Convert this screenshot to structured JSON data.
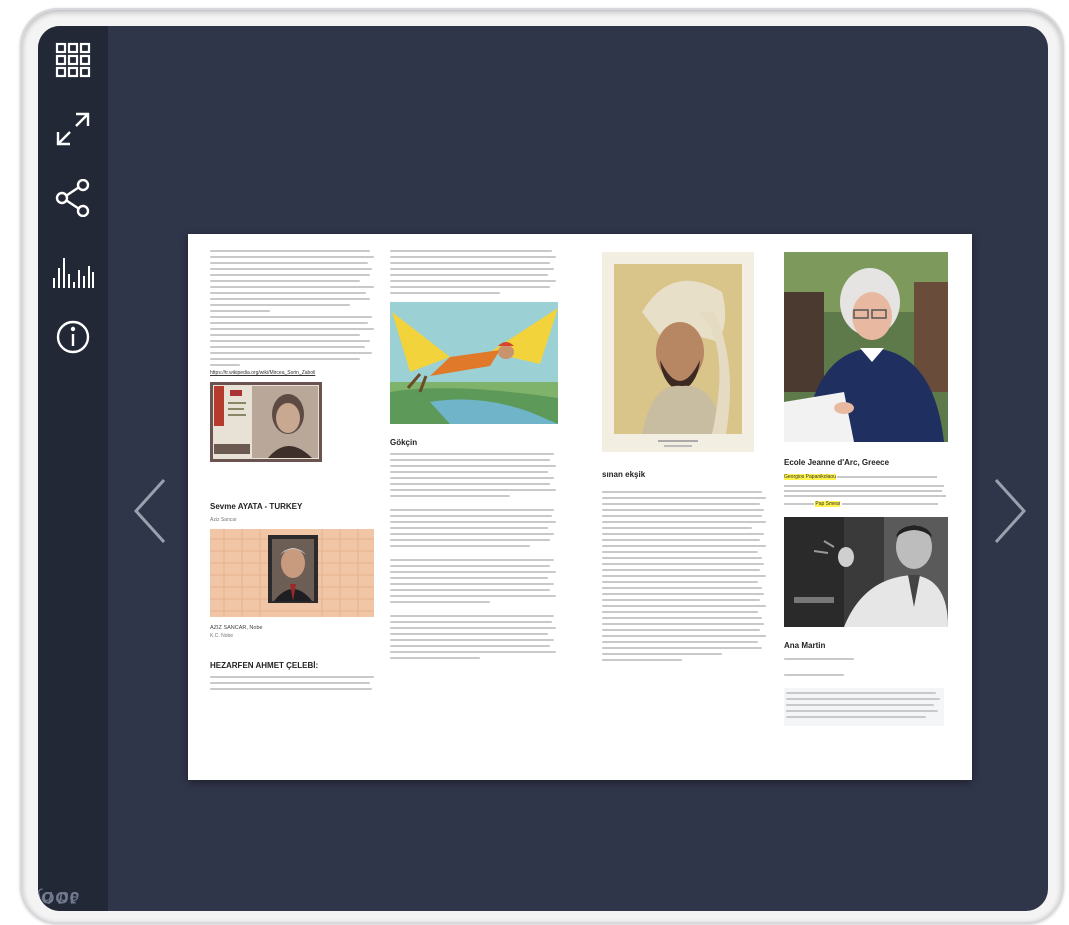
{
  "sidebar": {
    "buttons": [
      {
        "name": "grid-icon"
      },
      {
        "name": "fullscreen-icon"
      },
      {
        "name": "share-icon"
      },
      {
        "name": "stats-icon"
      },
      {
        "name": "info-icon"
      }
    ],
    "brand_by": "ed by",
    "brand_name": "JOOMAG"
  },
  "navigation": {
    "prev_icon": "chevron-left-icon",
    "next_icon": "chevron-right-icon"
  },
  "page": {
    "col1": {
      "link": "https://tr.wikipedia.org/wiki/Mircea_Sorin_Zaboli",
      "heading1": "Sevme AYATA - TURKEY",
      "heading1_sub": "Aziz Sancar",
      "caption1": "AZIZ SANCAR, Nobe",
      "caption2": "K.C. Nobe",
      "heading2": "HEZARFEN AHMET ÇELEBİ:"
    },
    "col2": {
      "heading": "Gökçin"
    },
    "col3": {
      "heading": "sınan ekşik"
    },
    "col4": {
      "heading": "Ecole Jeanne d'Arc, Greece",
      "highlight1": "Georgios Papanikolaou",
      "highlight2": "Pap Smear",
      "heading2": "Ana Martin"
    }
  },
  "colors": {
    "viewer_bg": "#30364a",
    "sidebar_bg": "#232837",
    "highlight": "#fff24a"
  }
}
